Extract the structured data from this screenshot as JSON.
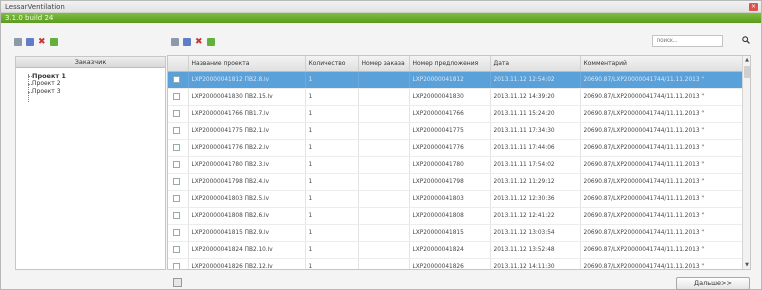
{
  "window": {
    "title": "LessarVentilation",
    "close_glyph": "×"
  },
  "version": "3.1.0 build 24",
  "search": {
    "placeholder": "поиск..."
  },
  "left_panel": {
    "header": "Заказчик",
    "projects": [
      "Проект 1",
      "Проект 2",
      "Проект 3"
    ]
  },
  "grid": {
    "columns": [
      "Название проекта",
      "Количество",
      "Номер заказа",
      "Номер предложения",
      "Дата",
      "Комментарий"
    ],
    "rows": [
      [
        "LXP20000041812 ПВ2.8.lv",
        "1",
        "",
        "LXP20000041812",
        "2013.11.12 12:54:02",
        "20690.87/LXP20000041744/11.11.2013 \""
      ],
      [
        "LXP20000041830 ПВ2.15.lv",
        "1",
        "",
        "LXP20000041830",
        "2013.11.12 14:39:20",
        "20690.87/LXP20000041744/11.11.2013 \""
      ],
      [
        "LXP20000041766 ПВ1.7.lv",
        "1",
        "",
        "LXP20000041766",
        "2013.11.11 15:24:20",
        "20690.87/LXP20000041744/11.11.2013 \""
      ],
      [
        "LXP20000041775 ПВ2.1.lv",
        "1",
        "",
        "LXP20000041775",
        "2013.11.11 17:34:30",
        "20690.87/LXP20000041744/11.11.2013 \""
      ],
      [
        "LXP20000041776 ПВ2.2.lv",
        "1",
        "",
        "LXP20000041776",
        "2013.11.11 17:44:06",
        "20690.87/LXP20000041744/11.11.2013 \""
      ],
      [
        "LXP20000041780 ПВ2.3.lv",
        "1",
        "",
        "LXP20000041780",
        "2013.11.11 17:54:02",
        "20690.87/LXP20000041744/11.11.2013 \""
      ],
      [
        "LXP20000041798 ПВ2.4.lv",
        "1",
        "",
        "LXP20000041798",
        "2013.11.12 11:29:12",
        "20690.87/LXP20000041744/11.11.2013 \""
      ],
      [
        "LXP20000041803 ПВ2.5.lv",
        "1",
        "",
        "LXP20000041803",
        "2013.11.12 12:30:36",
        "20690.87/LXP20000041744/11.11.2013 \""
      ],
      [
        "LXP20000041808 ПВ2.6.lv",
        "1",
        "",
        "LXP20000041808",
        "2013.11.12 12:41:22",
        "20690.87/LXP20000041744/11.11.2013 \""
      ],
      [
        "LXP20000041815 ПВ2.9.lv",
        "1",
        "",
        "LXP20000041815",
        "2013.11.12 13:03:54",
        "20690.87/LXP20000041744/11.11.2013 \""
      ],
      [
        "LXP20000041824 ПВ2.10.lv",
        "1",
        "",
        "LXP20000041824",
        "2013.11.12 13:52:48",
        "20690.87/LXP20000041744/11.11.2013 \""
      ],
      [
        "LXP20000041826 ПВ2.12.lv",
        "1",
        "",
        "LXP20000041826",
        "2013.11.12 14:11:30",
        "20690.87/LXP20000041744/11.11.2013 \""
      ]
    ],
    "selected_row": 0
  },
  "footer": {
    "next_label": "Дальше>>"
  },
  "colors": {
    "accent_green": "#6aad2c",
    "selection_blue": "#5aa0d9"
  }
}
